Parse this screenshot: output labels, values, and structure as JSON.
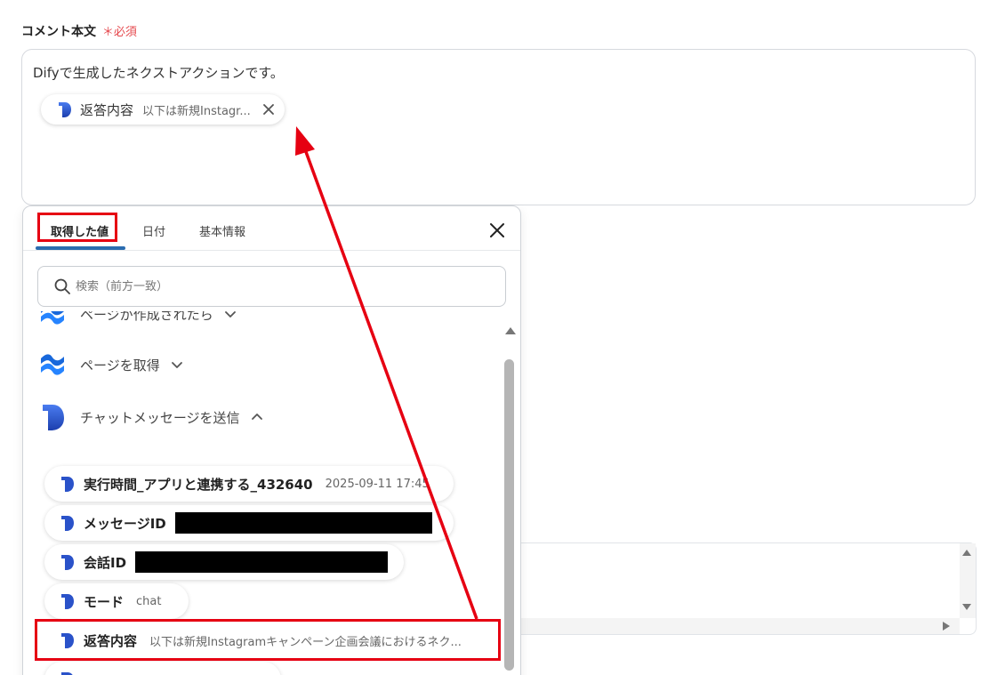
{
  "field": {
    "label": "コメント本文",
    "required_mark": "＊",
    "required_text": "必須"
  },
  "comment": {
    "text": "Difyで生成したネクストアクションです。",
    "chip": {
      "name": "返答内容",
      "value": "以下は新規Instagr..."
    }
  },
  "panel": {
    "tabs": [
      "取得した値",
      "日付",
      "基本情報"
    ],
    "search_placeholder": "検索（前方一致）",
    "groups": [
      {
        "label": "ページが作成されたら",
        "expanded": false,
        "icon": "confluence-icon"
      },
      {
        "label": "ページを取得",
        "expanded": false,
        "icon": "confluence-icon"
      },
      {
        "label": "チャットメッセージを送信",
        "expanded": true,
        "icon": "dify-icon"
      }
    ],
    "items": [
      {
        "name": "実行時間_アプリと連携する_432640",
        "value": "2025-09-11 17:45"
      },
      {
        "name": "メッセージID",
        "value": "",
        "redacted": true
      },
      {
        "name": "会話ID",
        "value": "",
        "redacted": true
      },
      {
        "name": "モード",
        "value": "chat"
      },
      {
        "name": "返答内容",
        "value": "以下は新規Instagramキャンペーン企画会議におけるネク..."
      }
    ]
  },
  "colors": {
    "highlight": "#e60012",
    "accent": "#2b6cb0",
    "required": "#e5484d"
  }
}
